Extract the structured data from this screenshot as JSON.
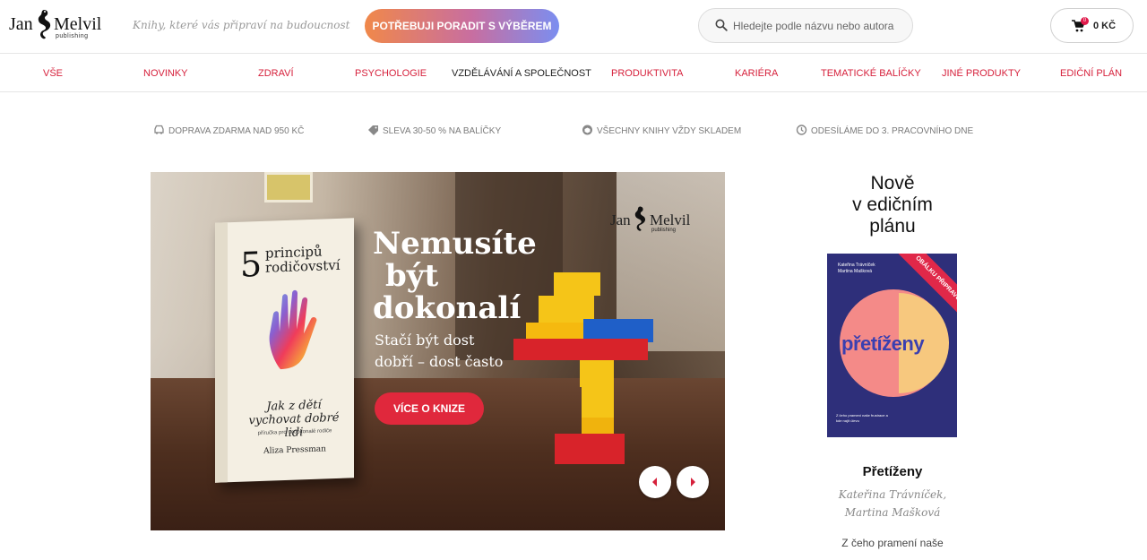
{
  "header": {
    "logo_word_left": "Jan",
    "logo_word_right": "Melvil",
    "logo_sub": "publishing",
    "tagline": "Knihy, které vás připraví na budoucnost",
    "advise_button": "POTŘEBUJI PORADIT S VÝBĚREM",
    "search_placeholder": "Hledejte podle názvu nebo autora",
    "cart_count": "0",
    "cart_price": "0 KČ"
  },
  "nav": {
    "items": [
      "VŠE",
      "NOVINKY",
      "ZDRAVÍ",
      "PSYCHOLOGIE",
      "VZDĚLÁVÁNÍ A SPOLEČNOST",
      "PRODUKTIVITA",
      "KARIÉRA",
      "TEMATICKÉ BALÍČKY",
      "JINÉ PRODUKTY",
      "EDIČNÍ PLÁN"
    ],
    "active_index": 4
  },
  "benefits": [
    {
      "icon": "car-icon",
      "text": "DOPRAVA ZDARMA NAD 950 KČ"
    },
    {
      "icon": "tag-icon",
      "text": "SLEVA 30-50 % NA BALÍČKY"
    },
    {
      "icon": "box-icon",
      "text": "VŠECHNY KNIHY VŽDY SKLADEM"
    },
    {
      "icon": "clock-icon",
      "text": "ODESÍLÁME DO 3. PRACOVNÍHO DNE"
    }
  ],
  "hero": {
    "book_number": "5",
    "book_title_l1": "principů",
    "book_title_l2": "rodičovství",
    "book_subtitle": "Jak z dětí vychovat dobré lidi",
    "book_tagline": "příručka pro nedokonalé rodiče",
    "book_author": "Aliza Pressman",
    "headline_l1": "Nemusíte",
    "headline_l2": "být",
    "headline_l3": "dokonalí",
    "subline_l1": "Stačí být dost",
    "subline_l2": "dobří – dost často",
    "cta": "VÍCE O KNIZE",
    "logo_left": "Jan",
    "logo_right": "Melvil",
    "logo_sub": "publishing"
  },
  "side": {
    "title_l1": "Nově",
    "title_l2": "v edičním",
    "title_l3": "plánu",
    "cover_authors": "Kateřina Trávníček\nMartina Mašková",
    "cover_title": "přetíženy",
    "cover_ribbon": "OBÁLKU PŘIPRAVUJEME",
    "cover_tag": "Z čeho pramení naše frustrace a kde najít úlevu",
    "book_name": "Přetíženy",
    "author_1": "Kateřina Trávníček,",
    "author_2": "Martina Mašková",
    "description": "Z čeho pramení naše"
  },
  "colors": {
    "accent": "#d6213c",
    "cta": "#e0283c",
    "cover_bg": "#2e2f7a"
  }
}
